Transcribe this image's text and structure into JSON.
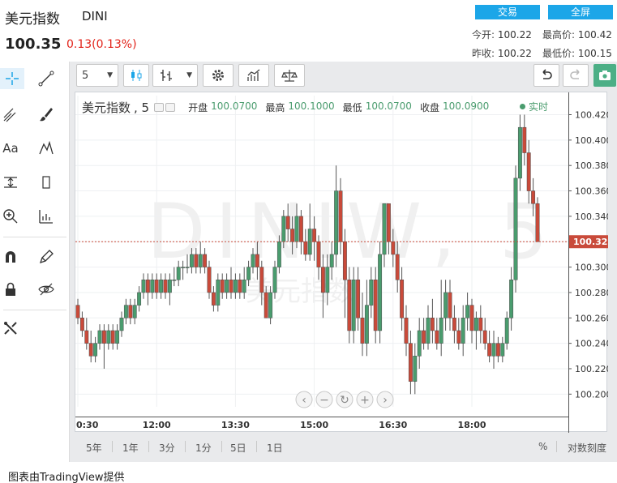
{
  "header": {
    "name": "美元指数",
    "code": "DINI",
    "price": "100.35",
    "change": "0.13(0.13%)",
    "trade_label": "交易",
    "fullscreen_label": "全屏",
    "stats": {
      "open_label": "今开:",
      "open_value": "100.22",
      "high_label": "最高价:",
      "high_value": "100.42",
      "prev_close_label": "昨收:",
      "prev_close_value": "100.22",
      "low_label": "最低价:",
      "low_value": "100.15"
    }
  },
  "toolbar": {
    "interval_value": "5"
  },
  "legend": {
    "symbol": "美元指数",
    "interval": ", 5",
    "open_label": "开盘",
    "open_value": "100.0700",
    "high_label": "最高",
    "high_value": "100.1000",
    "low_label": "最低",
    "low_value": "100.0700",
    "close_label": "收盘",
    "close_value": "100.0900",
    "realtime_label": "实时"
  },
  "watermark": {
    "big": "DINIW, 5",
    "small": "美元指数"
  },
  "colors": {
    "up": "#4a9c6e",
    "down": "#c94a3a",
    "accent": "#1ca6e8",
    "price_line": "#c94a3a",
    "realtime": "#4a9c6e"
  },
  "chart_data": {
    "type": "candlestick",
    "ylim": [
      100.19,
      100.435
    ],
    "y_ticks": [
      "100.4200",
      "100.4000",
      "100.3800",
      "100.3600",
      "100.3400",
      "100.3200",
      "100.3000",
      "100.2800",
      "100.2600",
      "100.2400",
      "100.2200",
      "100.2000"
    ],
    "y_tick_values": [
      100.42,
      100.4,
      100.38,
      100.36,
      100.34,
      100.32,
      100.3,
      100.28,
      100.26,
      100.24,
      100.22,
      100.2
    ],
    "current_price_label": "100.3200",
    "current_price": 100.32,
    "x_ticks": [
      "0:30",
      "12:00",
      "13:30",
      "15:00",
      "16:30",
      "18:00"
    ],
    "x_tick_index": [
      0,
      18,
      36,
      54,
      72,
      90
    ],
    "candles": [
      [
        100.27,
        100.26,
        100.275,
        100.255
      ],
      [
        100.26,
        100.25,
        100.265,
        100.245
      ],
      [
        100.25,
        100.24,
        100.26,
        100.235
      ],
      [
        100.24,
        100.23,
        100.25,
        100.225
      ],
      [
        100.23,
        100.24,
        100.245,
        100.225
      ],
      [
        100.24,
        100.25,
        100.255,
        100.235
      ],
      [
        100.25,
        100.24,
        100.255,
        100.22
      ],
      [
        100.24,
        100.25,
        100.255,
        100.235
      ],
      [
        100.25,
        100.24,
        100.255,
        100.235
      ],
      [
        100.24,
        100.25,
        100.255,
        100.235
      ],
      [
        100.25,
        100.26,
        100.265,
        100.245
      ],
      [
        100.26,
        100.27,
        100.275,
        100.255
      ],
      [
        100.27,
        100.26,
        100.275,
        100.255
      ],
      [
        100.26,
        100.27,
        100.275,
        100.255
      ],
      [
        100.27,
        100.28,
        100.285,
        100.265
      ],
      [
        100.28,
        100.29,
        100.295,
        100.275
      ],
      [
        100.29,
        100.28,
        100.295,
        100.27
      ],
      [
        100.28,
        100.29,
        100.295,
        100.275
      ],
      [
        100.29,
        100.28,
        100.295,
        100.275
      ],
      [
        100.28,
        100.29,
        100.295,
        100.275
      ],
      [
        100.29,
        100.28,
        100.295,
        100.275
      ],
      [
        100.28,
        100.29,
        100.295,
        100.27
      ],
      [
        100.29,
        100.29,
        100.3,
        100.285
      ],
      [
        100.29,
        100.3,
        100.305,
        100.285
      ],
      [
        100.3,
        100.3,
        100.305,
        100.29
      ],
      [
        100.3,
        100.3,
        100.31,
        100.295
      ],
      [
        100.3,
        100.31,
        100.315,
        100.295
      ],
      [
        100.31,
        100.3,
        100.315,
        100.295
      ],
      [
        100.3,
        100.31,
        100.32,
        100.295
      ],
      [
        100.31,
        100.3,
        100.315,
        100.295
      ],
      [
        100.3,
        100.28,
        100.305,
        100.275
      ],
      [
        100.28,
        100.27,
        100.285,
        100.265
      ],
      [
        100.27,
        100.29,
        100.295,
        100.265
      ],
      [
        100.29,
        100.28,
        100.295,
        100.275
      ],
      [
        100.28,
        100.29,
        100.295,
        100.275
      ],
      [
        100.29,
        100.28,
        100.3,
        100.275
      ],
      [
        100.28,
        100.29,
        100.295,
        100.275
      ],
      [
        100.29,
        100.28,
        100.295,
        100.275
      ],
      [
        100.28,
        100.29,
        100.3,
        100.275
      ],
      [
        100.29,
        100.3,
        100.305,
        100.285
      ],
      [
        100.3,
        100.31,
        100.315,
        100.295
      ],
      [
        100.31,
        100.3,
        100.32,
        100.29
      ],
      [
        100.3,
        100.28,
        100.305,
        100.27
      ],
      [
        100.28,
        100.26,
        100.285,
        100.26
      ],
      [
        100.26,
        100.28,
        100.285,
        100.255
      ],
      [
        100.28,
        100.3,
        100.305,
        100.275
      ],
      [
        100.3,
        100.32,
        100.325,
        100.295
      ],
      [
        100.32,
        100.34,
        100.345,
        100.315
      ],
      [
        100.34,
        100.33,
        100.35,
        100.32
      ],
      [
        100.33,
        100.32,
        100.34,
        100.31
      ],
      [
        100.32,
        100.34,
        100.35,
        100.315
      ],
      [
        100.34,
        100.32,
        100.345,
        100.31
      ],
      [
        100.32,
        100.31,
        100.33,
        100.305
      ],
      [
        100.31,
        100.33,
        100.35,
        100.305
      ],
      [
        100.33,
        100.32,
        100.34,
        100.305
      ],
      [
        100.32,
        100.3,
        100.325,
        100.29
      ],
      [
        100.3,
        100.28,
        100.31,
        100.26
      ],
      [
        100.28,
        100.3,
        100.31,
        100.27
      ],
      [
        100.3,
        100.31,
        100.32,
        100.29
      ],
      [
        100.31,
        100.36,
        100.38,
        100.3
      ],
      [
        100.36,
        100.32,
        100.37,
        100.31
      ],
      [
        100.32,
        100.29,
        100.33,
        100.26
      ],
      [
        100.29,
        100.25,
        100.3,
        100.24
      ],
      [
        100.25,
        100.29,
        100.3,
        100.24
      ],
      [
        100.29,
        100.26,
        100.3,
        100.25
      ],
      [
        100.26,
        100.24,
        100.28,
        100.23
      ],
      [
        100.24,
        100.27,
        100.29,
        100.23
      ],
      [
        100.27,
        100.29,
        100.3,
        100.26
      ],
      [
        100.29,
        100.25,
        100.3,
        100.24
      ],
      [
        100.25,
        100.31,
        100.32,
        100.24
      ],
      [
        100.31,
        100.35,
        100.35,
        100.3
      ],
      [
        100.35,
        100.32,
        100.35,
        100.31
      ],
      [
        100.32,
        100.31,
        100.33,
        100.3
      ],
      [
        100.31,
        100.29,
        100.32,
        100.28
      ],
      [
        100.29,
        100.26,
        100.3,
        100.25
      ],
      [
        100.26,
        100.24,
        100.27,
        100.23
      ],
      [
        100.24,
        100.21,
        100.25,
        100.2
      ],
      [
        100.21,
        100.23,
        100.24,
        100.2
      ],
      [
        100.23,
        100.25,
        100.26,
        100.22
      ],
      [
        100.25,
        100.24,
        100.26,
        100.235
      ],
      [
        100.24,
        100.26,
        100.27,
        100.235
      ],
      [
        100.26,
        100.25,
        100.275,
        100.24
      ],
      [
        100.25,
        100.24,
        100.26,
        100.235
      ],
      [
        100.24,
        100.26,
        100.29,
        100.23
      ],
      [
        100.26,
        100.28,
        100.29,
        100.25
      ],
      [
        100.28,
        100.26,
        100.29,
        100.25
      ],
      [
        100.26,
        100.25,
        100.27,
        100.24
      ],
      [
        100.25,
        100.24,
        100.26,
        100.235
      ],
      [
        100.24,
        100.26,
        100.27,
        100.23
      ],
      [
        100.26,
        100.27,
        100.28,
        100.25
      ],
      [
        100.27,
        100.25,
        100.275,
        100.24
      ],
      [
        100.25,
        100.26,
        100.265,
        100.235
      ],
      [
        100.26,
        100.25,
        100.27,
        100.24
      ],
      [
        100.25,
        100.24,
        100.26,
        100.235
      ],
      [
        100.24,
        100.23,
        100.25,
        100.225
      ],
      [
        100.23,
        100.24,
        100.25,
        100.22
      ],
      [
        100.24,
        100.23,
        100.245,
        100.225
      ],
      [
        100.23,
        100.24,
        100.245,
        100.225
      ],
      [
        100.24,
        100.26,
        100.265,
        100.235
      ],
      [
        100.26,
        100.29,
        100.3,
        100.25
      ],
      [
        100.29,
        100.37,
        100.38,
        100.28
      ],
      [
        100.37,
        100.41,
        100.42,
        100.36
      ],
      [
        100.41,
        100.39,
        100.42,
        100.38
      ],
      [
        100.39,
        100.36,
        100.4,
        100.35
      ],
      [
        100.36,
        100.35,
        100.37,
        100.34
      ],
      [
        100.35,
        100.32,
        100.355,
        100.32
      ]
    ]
  },
  "bottom_bar": {
    "ranges": [
      "5年",
      "1年",
      "3分",
      "1分",
      "5日",
      "1日"
    ],
    "percent_label": "%",
    "log_label": "对数刻度"
  },
  "footer": {
    "credit": "图表由TradingView提供"
  }
}
